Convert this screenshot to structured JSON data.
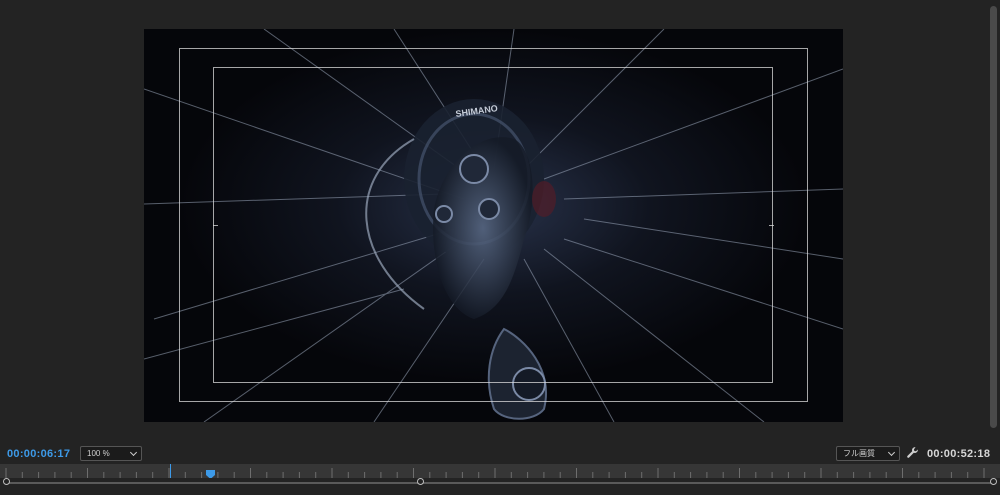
{
  "monitor": {
    "current_timecode": "00:00:06:17",
    "duration_timecode": "00:00:52:18",
    "zoom": {
      "selected": "100 %"
    },
    "quality": {
      "selected": "フル画質"
    },
    "settings_icon": "wrench-icon"
  },
  "video": {
    "overlay_text": "SHIMANO",
    "show_safe_margins": true
  },
  "colors": {
    "accent": "#3d9ae8",
    "background": "#232323",
    "ruler": "#363636"
  }
}
